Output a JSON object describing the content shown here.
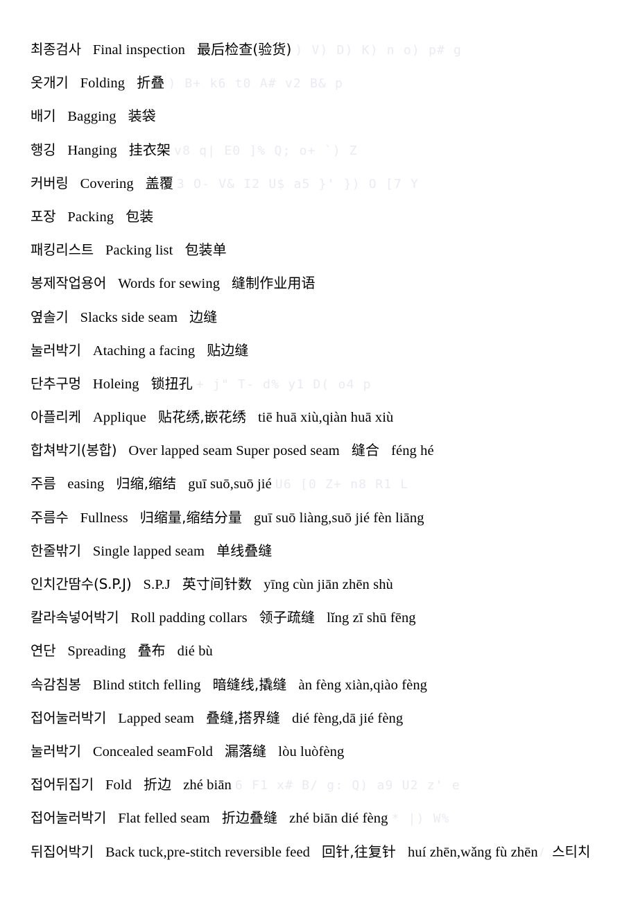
{
  "document": {
    "title": "Sewing and Packing Terminology Glossary (Korean-English-Chinese)",
    "background_color": "#ffffff",
    "text_color": "#000000",
    "watermark_color": "#ece9f2"
  },
  "entries": [
    {
      "korean": "최종검사",
      "english": "Final inspection",
      "chinese": "最后检查(验货)",
      "pinyin": "",
      "watermark": ") V) D) K) n   o) p# g"
    },
    {
      "korean": "옷개기",
      "english": "Folding",
      "chinese": "折叠",
      "pinyin": "",
      "watermark": ") B+ k6 t0 A# v2 B& p"
    },
    {
      "korean": "배기",
      "english": "Bagging",
      "chinese": "装袋",
      "pinyin": "",
      "watermark": ""
    },
    {
      "korean": "행깅",
      "english": "Hanging",
      "chinese": "挂衣架",
      "pinyin": "",
      "watermark": "v8 q| E0 ]% Q; o+ `) Z"
    },
    {
      "korean": "커버링",
      "english": "Covering",
      "chinese": "盖覆",
      "pinyin": "",
      "watermark": "3 O- V& I2 U$ a5 }' }) O   [7 Y"
    },
    {
      "korean": "포장",
      "english": "Packing",
      "chinese": "包装",
      "pinyin": "",
      "watermark": ""
    },
    {
      "korean": "패킹리스트",
      "english": "Packing list",
      "chinese": "包装单",
      "pinyin": "",
      "watermark": ""
    },
    {
      "korean": "봉제작업용어",
      "english": "Words for sewing",
      "chinese": "缝制作业用语",
      "pinyin": "",
      "watermark": ""
    },
    {
      "korean": "옆솔기",
      "english": "Slacks side seam",
      "chinese": "边缝",
      "pinyin": "",
      "watermark": ""
    },
    {
      "korean": "눌러박기",
      "english": "Ataching a facing",
      "chinese": "贴边缝",
      "pinyin": "",
      "watermark": ""
    },
    {
      "korean": "단추구멍",
      "english": "Holeing",
      "chinese": "锁扭孔",
      "pinyin": "",
      "watermark": "+ j\" T- d% y1 D( o4 p"
    },
    {
      "korean": "아플리케",
      "english": "Applique",
      "chinese": "贴花绣,嵌花绣",
      "pinyin": "tiē huā xiù,qiàn huā xiù",
      "watermark": ""
    },
    {
      "korean": "합쳐박기(봉합)",
      "english": "Over lapped seam Super posed seam",
      "chinese": "缝合",
      "pinyin": "féng hé",
      "watermark": ""
    },
    {
      "korean": "주름",
      "english": "easing",
      "chinese": "归缩,缩结",
      "pinyin": "guī suō,suō jié",
      "watermark": "U6 [0 Z+ n8 R1 L"
    },
    {
      "korean": "주름수",
      "english": "Fullness",
      "chinese": "归缩量,缩结分量",
      "pinyin": "guī suō liàng,suō jié fèn liāng",
      "watermark": ""
    },
    {
      "korean": "한줄밖기",
      "english": "Single lapped seam",
      "chinese": "单线叠缝",
      "pinyin": "",
      "watermark": ""
    },
    {
      "korean": "인치간땀수(S.P.J)",
      "english": "S.P.J",
      "chinese": "英寸间针数",
      "pinyin": "yīng cùn jiān zhēn shù",
      "watermark": ""
    },
    {
      "korean": "칼라속넣어박기",
      "english": "Roll padding collars",
      "chinese": "领子疏缝",
      "pinyin": "lǐng zī shū fēng",
      "watermark": ""
    },
    {
      "korean": "연단",
      "english": "Spreading",
      "chinese": "叠布",
      "pinyin": "dié bù",
      "watermark": ""
    },
    {
      "korean": "속감침봉",
      "english": "Blind stitch felling",
      "chinese": "暗缝线,撬缝",
      "pinyin": "àn fèng xiàn,qiào fèng",
      "watermark": ""
    },
    {
      "korean": "접어눌러박기",
      "english": "Lapped seam",
      "chinese": "叠缝,搭界缝",
      "pinyin": "dié fèng,dā jié fèng",
      "watermark": ""
    },
    {
      "korean": "눌러박기",
      "english": "Concealed seamFold",
      "chinese": "漏落缝",
      "pinyin": "lòu luòfèng",
      "watermark": ""
    },
    {
      "korean": "접어뒤집기",
      "english": "Fold",
      "chinese": "折边",
      "pinyin": "zhé biān",
      "watermark": "6 F1 x# B/ g: Q) a9 U2 z' e"
    },
    {
      "korean": "접어눌러박기",
      "english": "Flat felled seam",
      "chinese": "折边叠缝",
      "pinyin": "zhé biān dié fèng",
      "watermark": "* |) W%"
    },
    {
      "korean": "뒤집어박기",
      "english": "Back tuck,pre-stitch reversible feed",
      "chinese": "回针,往复针",
      "pinyin": "huí zhēn,wǎng fù zhēn",
      "trailing_korean": "스티치",
      "watermark": ""
    }
  ]
}
